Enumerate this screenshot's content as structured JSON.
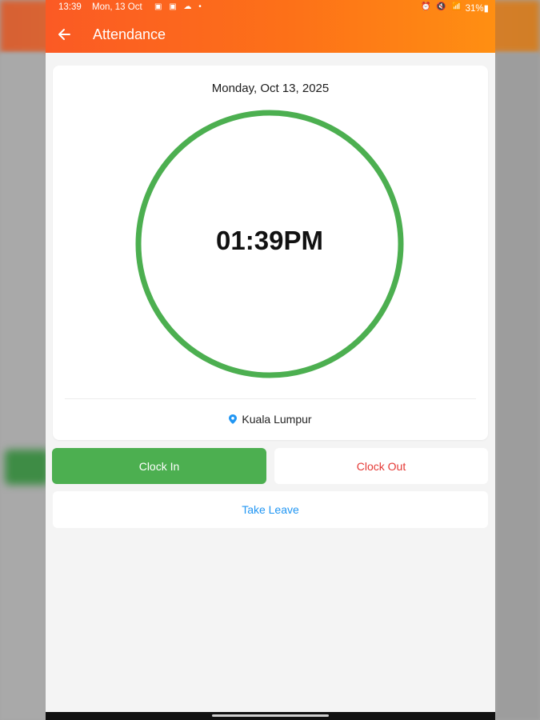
{
  "status_bar": {
    "time": "13:39",
    "date": "Mon, 13 Oct",
    "notif_icons": "▣ ▣ ☁ •",
    "system_icons": "⏰ 🔇 📶",
    "battery": "31%▮"
  },
  "app_bar": {
    "title": "Attendance",
    "back_icon": "arrow-left",
    "gradient": [
      "#fb5a24",
      "#ff8f12"
    ]
  },
  "card": {
    "date": "Monday, Oct 13, 2025",
    "time": "01:39PM",
    "ring_color": "#4caf50",
    "location": "Kuala Lumpur",
    "location_icon": "map-pin",
    "location_icon_color": "#2196f3"
  },
  "actions": {
    "clock_in": "Clock In",
    "clock_out": "Clock Out",
    "take_leave": "Take Leave"
  },
  "colors": {
    "clock_in_bg": "#4caf50",
    "clock_out_text": "#e53935",
    "take_leave_text": "#2196f3"
  }
}
